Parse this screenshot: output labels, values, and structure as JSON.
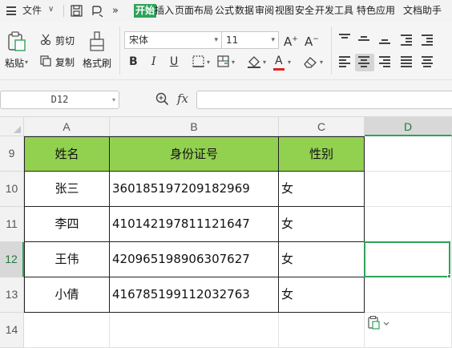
{
  "menubar": {
    "file_label": "文件",
    "tabs": [
      "插入",
      "页面布局",
      "公式",
      "数据",
      "审阅",
      "视图",
      "安全",
      "开发工具",
      "特色应用",
      "文档助手"
    ],
    "active_tab": "开始"
  },
  "ribbon": {
    "paste_label": "粘贴",
    "cut_label": "剪切",
    "copy_label": "复制",
    "format_painter_label": "格式刷",
    "font_name": "宋体",
    "font_size": "11",
    "grow_font": "A",
    "shrink_font": "A",
    "bold": "B",
    "italic": "I",
    "underline": "U",
    "font_color_letter": "A"
  },
  "formula_bar": {
    "name_box": "D12",
    "fx_label": "fx",
    "formula": ""
  },
  "grid": {
    "columns": [
      "A",
      "B",
      "C",
      "D"
    ],
    "rows": [
      "9",
      "10",
      "11",
      "12",
      "13",
      "14"
    ],
    "selected_column": "D",
    "selected_row": "12",
    "header_row": [
      "姓名",
      "身份证号",
      "性别"
    ],
    "data_rows": [
      [
        "张三",
        "360185197209182969",
        "女"
      ],
      [
        "李四",
        "410142197811121647",
        "女"
      ],
      [
        "王伟",
        "420965198906307627",
        "女"
      ],
      [
        "小倩",
        "416785199112032763",
        "女"
      ]
    ]
  },
  "colors": {
    "accent_green": "#2ea359",
    "header_fill": "#92d050"
  }
}
